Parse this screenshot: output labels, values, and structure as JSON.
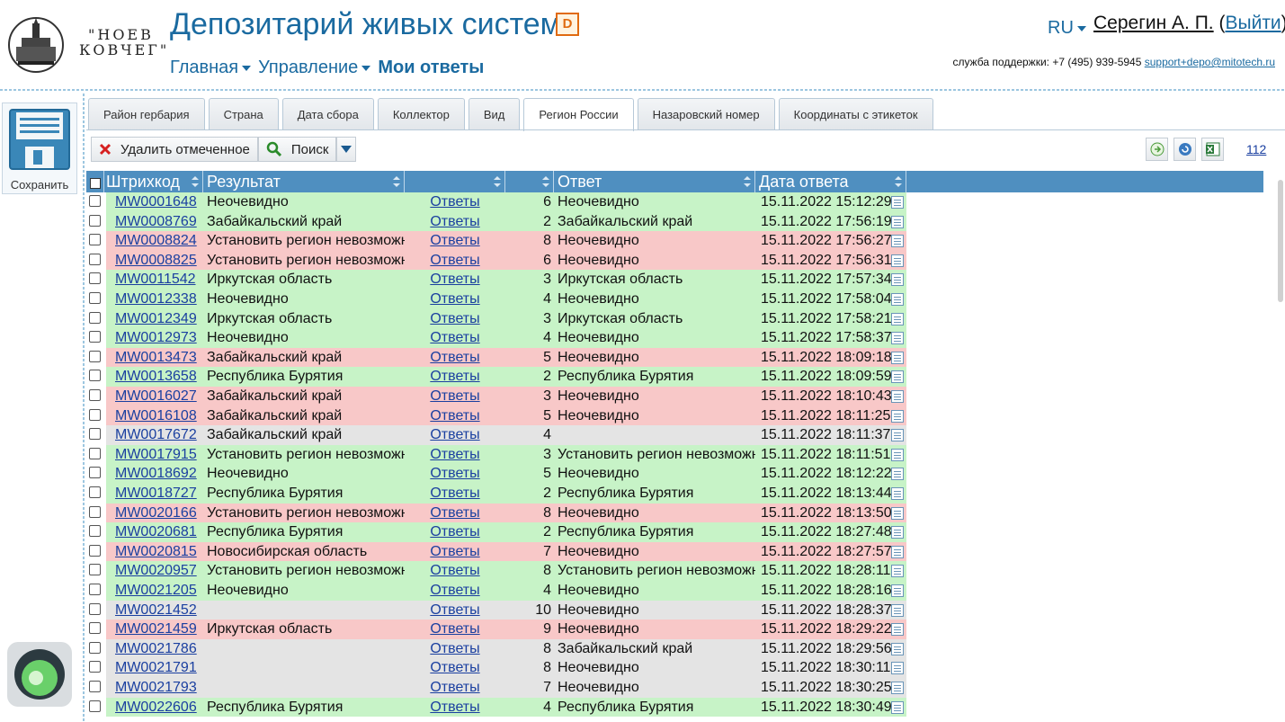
{
  "header": {
    "logo_text_line1": "\"НОЕВ",
    "logo_text_line2": "КОВЧЕГ\"",
    "app_title": "Депозитарий живых систем",
    "badge": "D",
    "nav": [
      {
        "label": "Главная"
      },
      {
        "label": "Управление"
      },
      {
        "label": "Мои ответы"
      }
    ],
    "lang": "RU",
    "user_name": "Серегин А. П.",
    "logout_label": "Выйти",
    "support_text": "служба поддержки: +7 (495) 939-5945",
    "support_email": "support+depo@mitotech.ru"
  },
  "save_panel": {
    "label": "Сохранить"
  },
  "tabs": [
    "Район гербария",
    "Страна",
    "Дата сбора",
    "Коллектор",
    "Вид",
    "Регион России",
    "Назаровский номер",
    "Координаты с этикеток"
  ],
  "active_tab": "Регион России",
  "toolbar": {
    "delete_label": "Удалить отмеченное",
    "search_label": "Поиск",
    "count": "112"
  },
  "grid": {
    "columns": [
      "Штрихкод",
      "Результат",
      "",
      "",
      "Ответ",
      "Дата ответа"
    ],
    "answers_link": "Ответы",
    "rows": [
      {
        "bc": "MW0001648",
        "res": "Неочевидно",
        "num": "6",
        "reg": "Неочевидно",
        "dt": "15.11.2022 15:12:29",
        "color": "green"
      },
      {
        "bc": "MW0008769",
        "res": "Забайкальский край",
        "num": "2",
        "reg": "Забайкальский край",
        "dt": "15.11.2022 17:56:19",
        "color": "green"
      },
      {
        "bc": "MW0008824",
        "res": "Установить регион невозможно",
        "num": "8",
        "reg": "Неочевидно",
        "dt": "15.11.2022 17:56:27",
        "color": "red"
      },
      {
        "bc": "MW0008825",
        "res": "Установить регион невозможно",
        "num": "6",
        "reg": "Неочевидно",
        "dt": "15.11.2022 17:56:31",
        "color": "red"
      },
      {
        "bc": "MW0011542",
        "res": "Иркутская область",
        "num": "3",
        "reg": "Иркутская область",
        "dt": "15.11.2022 17:57:34",
        "color": "green"
      },
      {
        "bc": "MW0012338",
        "res": "Неочевидно",
        "num": "4",
        "reg": "Неочевидно",
        "dt": "15.11.2022 17:58:04",
        "color": "green"
      },
      {
        "bc": "MW0012349",
        "res": "Иркутская область",
        "num": "3",
        "reg": "Иркутская область",
        "dt": "15.11.2022 17:58:21",
        "color": "green"
      },
      {
        "bc": "MW0012973",
        "res": "Неочевидно",
        "num": "4",
        "reg": "Неочевидно",
        "dt": "15.11.2022 17:58:37",
        "color": "green"
      },
      {
        "bc": "MW0013473",
        "res": "Забайкальский край",
        "num": "5",
        "reg": "Неочевидно",
        "dt": "15.11.2022 18:09:18",
        "color": "red"
      },
      {
        "bc": "MW0013658",
        "res": "Республика Бурятия",
        "num": "2",
        "reg": "Республика Бурятия",
        "dt": "15.11.2022 18:09:59",
        "color": "green"
      },
      {
        "bc": "MW0016027",
        "res": "Забайкальский край",
        "num": "3",
        "reg": "Неочевидно",
        "dt": "15.11.2022 18:10:43",
        "color": "red"
      },
      {
        "bc": "MW0016108",
        "res": "Забайкальский край",
        "num": "5",
        "reg": "Неочевидно",
        "dt": "15.11.2022 18:11:25",
        "color": "red"
      },
      {
        "bc": "MW0017672",
        "res": "Забайкальский край",
        "num": "4",
        "reg": "",
        "dt": "15.11.2022 18:11:37",
        "color": "gray"
      },
      {
        "bc": "MW0017915",
        "res": "Установить регион невозможно",
        "num": "3",
        "reg": "Установить регион невозможно",
        "dt": "15.11.2022 18:11:51",
        "color": "green"
      },
      {
        "bc": "MW0018692",
        "res": "Неочевидно",
        "num": "5",
        "reg": "Неочевидно",
        "dt": "15.11.2022 18:12:22",
        "color": "green"
      },
      {
        "bc": "MW0018727",
        "res": "Республика Бурятия",
        "num": "2",
        "reg": "Республика Бурятия",
        "dt": "15.11.2022 18:13:44",
        "color": "green"
      },
      {
        "bc": "MW0020166",
        "res": "Установить регион невозможно",
        "num": "8",
        "reg": "Неочевидно",
        "dt": "15.11.2022 18:13:50",
        "color": "red"
      },
      {
        "bc": "MW0020681",
        "res": "Республика Бурятия",
        "num": "2",
        "reg": "Республика Бурятия",
        "dt": "15.11.2022 18:27:48",
        "color": "green"
      },
      {
        "bc": "MW0020815",
        "res": "Новосибирская область",
        "num": "7",
        "reg": "Неочевидно",
        "dt": "15.11.2022 18:27:57",
        "color": "red"
      },
      {
        "bc": "MW0020957",
        "res": "Установить регион невозможно",
        "num": "8",
        "reg": "Установить регион невозможно",
        "dt": "15.11.2022 18:28:11",
        "color": "green"
      },
      {
        "bc": "MW0021205",
        "res": "Неочевидно",
        "num": "4",
        "reg": "Неочевидно",
        "dt": "15.11.2022 18:28:16",
        "color": "green"
      },
      {
        "bc": "MW0021452",
        "res": "",
        "num": "10",
        "reg": "Неочевидно",
        "dt": "15.11.2022 18:28:37",
        "color": "gray"
      },
      {
        "bc": "MW0021459",
        "res": "Иркутская область",
        "num": "9",
        "reg": "Неочевидно",
        "dt": "15.11.2022 18:29:22",
        "color": "red"
      },
      {
        "bc": "MW0021786",
        "res": "",
        "num": "8",
        "reg": "Забайкальский край",
        "dt": "15.11.2022 18:29:56",
        "color": "gray"
      },
      {
        "bc": "MW0021791",
        "res": "",
        "num": "8",
        "reg": "Неочевидно",
        "dt": "15.11.2022 18:30:11",
        "color": "gray"
      },
      {
        "bc": "MW0021793",
        "res": "",
        "num": "7",
        "reg": "Неочевидно",
        "dt": "15.11.2022 18:30:25",
        "color": "gray"
      },
      {
        "bc": "MW0022606",
        "res": "Республика Бурятия",
        "num": "4",
        "reg": "Республика Бурятия",
        "dt": "15.11.2022 18:30:49",
        "color": "green"
      }
    ]
  },
  "colors": {
    "accent": "#1a6aa0",
    "header_bar": "#4f8fc0",
    "green": "#c7f3c7",
    "red": "#f8c8c8",
    "gray": "#e4e4e4"
  }
}
